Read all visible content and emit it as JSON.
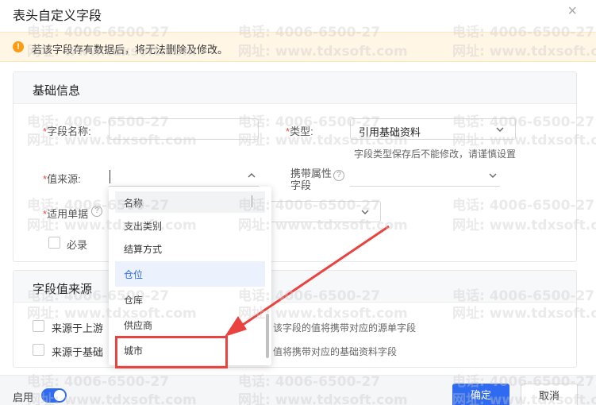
{
  "dialog": {
    "title": "表头自定义字段",
    "close": "×"
  },
  "alert": {
    "icon": "warning-icon",
    "icon_glyph": "!",
    "text": "若该字段存有数据后，将无法删除及修改。"
  },
  "basic": {
    "title": "基础信息",
    "field_name_label": "字段名称:",
    "field_name_value": "",
    "type_label": "类型:",
    "type_value": "引用基础资料",
    "type_hint": "字段类型保存后不能修改，请谨慎设置",
    "value_source_label": "值来源:",
    "carry_attr_label_line1": "携带属性",
    "carry_attr_label_line2": "字段",
    "apply_doc_label": "适用单据",
    "required_label": "必录",
    "help_glyph": "?",
    "req_star": "*"
  },
  "source": {
    "title": "字段值来源",
    "upstream_label": "来源于上游",
    "upstream_hint": "该字段的值将携带对应的源单字段",
    "basic_data_label": "来源于基础",
    "basic_data_hint": "值将携带对应的基础资料字段"
  },
  "dropdown": {
    "header": "名称",
    "items": [
      "支出类别",
      "结算方式",
      "仓位",
      "仓库",
      "供应商",
      "城市"
    ],
    "active_index": 2
  },
  "footer": {
    "enable_label": "启用",
    "enabled": true,
    "confirm": "确定",
    "cancel": "取消"
  },
  "watermarks": {
    "phone": "电话: 4006-6500-27",
    "site": "网址: www.tdxsoft.com"
  },
  "colors": {
    "primary": "#2f6bf0",
    "warning": "#fa9d14",
    "required": "#e94a3f",
    "annotation": "#e9423f"
  }
}
